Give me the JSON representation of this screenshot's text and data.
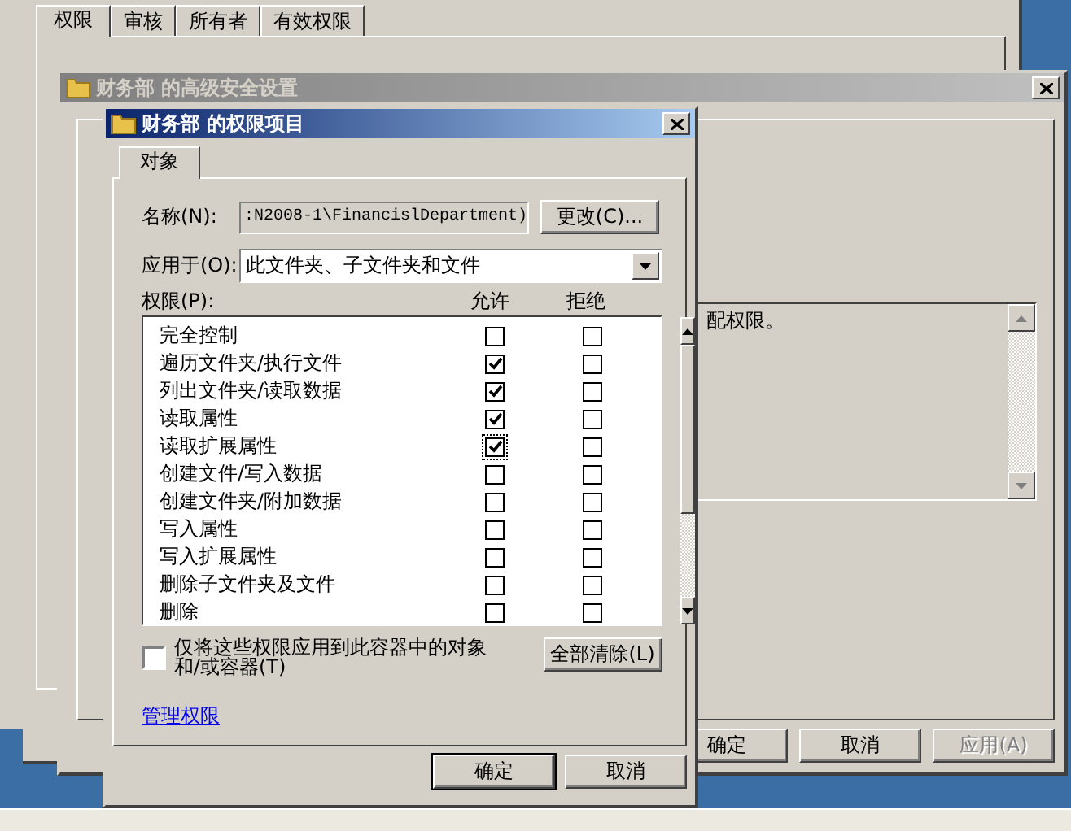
{
  "properties_window": {
    "tabs": [
      {
        "label": "权限",
        "selected": true
      },
      {
        "label": "审核",
        "selected": false
      },
      {
        "label": "所有者",
        "selected": false
      },
      {
        "label": "有效权限",
        "selected": false
      }
    ]
  },
  "advanced_window": {
    "title": "财务部 的高级安全设置",
    "active": false,
    "description": "配权限。",
    "buttons": [
      {
        "label": "确定",
        "disabled": false
      },
      {
        "label": "取消",
        "disabled": false
      },
      {
        "label": "应用(A)",
        "disabled": true
      }
    ]
  },
  "entry_dialog": {
    "title": "财务部 的权限项目",
    "active": true,
    "tab": "对象",
    "name_label": "名称(N):",
    "name_value": ":N2008-1\\FinancislDepartment)",
    "change_button": "更改(C)...",
    "apply_label": "应用于(O):",
    "apply_value": "此文件夹、子文件夹和文件",
    "permissions_label": "权限(P):",
    "columns": [
      "允许",
      "拒绝"
    ],
    "permissions": [
      {
        "name": "完全控制",
        "allow": false,
        "deny": false,
        "focused": false
      },
      {
        "name": "遍历文件夹/执行文件",
        "allow": true,
        "deny": false,
        "focused": false
      },
      {
        "name": "列出文件夹/读取数据",
        "allow": true,
        "deny": false,
        "focused": false
      },
      {
        "name": "读取属性",
        "allow": true,
        "deny": false,
        "focused": false
      },
      {
        "name": "读取扩展属性",
        "allow": true,
        "deny": false,
        "focused": true
      },
      {
        "name": "创建文件/写入数据",
        "allow": false,
        "deny": false,
        "focused": false
      },
      {
        "name": "创建文件夹/附加数据",
        "allow": false,
        "deny": false,
        "focused": false
      },
      {
        "name": "写入属性",
        "allow": false,
        "deny": false,
        "focused": false
      },
      {
        "name": "写入扩展属性",
        "allow": false,
        "deny": false,
        "focused": false
      },
      {
        "name": "删除子文件夹及文件",
        "allow": false,
        "deny": false,
        "focused": false
      },
      {
        "name": "删除",
        "allow": false,
        "deny": false,
        "focused": false
      }
    ],
    "only_container": {
      "label": "仅将这些权限应用到此容器中的对象和/或容器(T)",
      "checked": false
    },
    "clear_all_button": "全部清除(L)",
    "manage_link": "管理权限",
    "buttons": [
      "确定",
      "取消"
    ]
  }
}
